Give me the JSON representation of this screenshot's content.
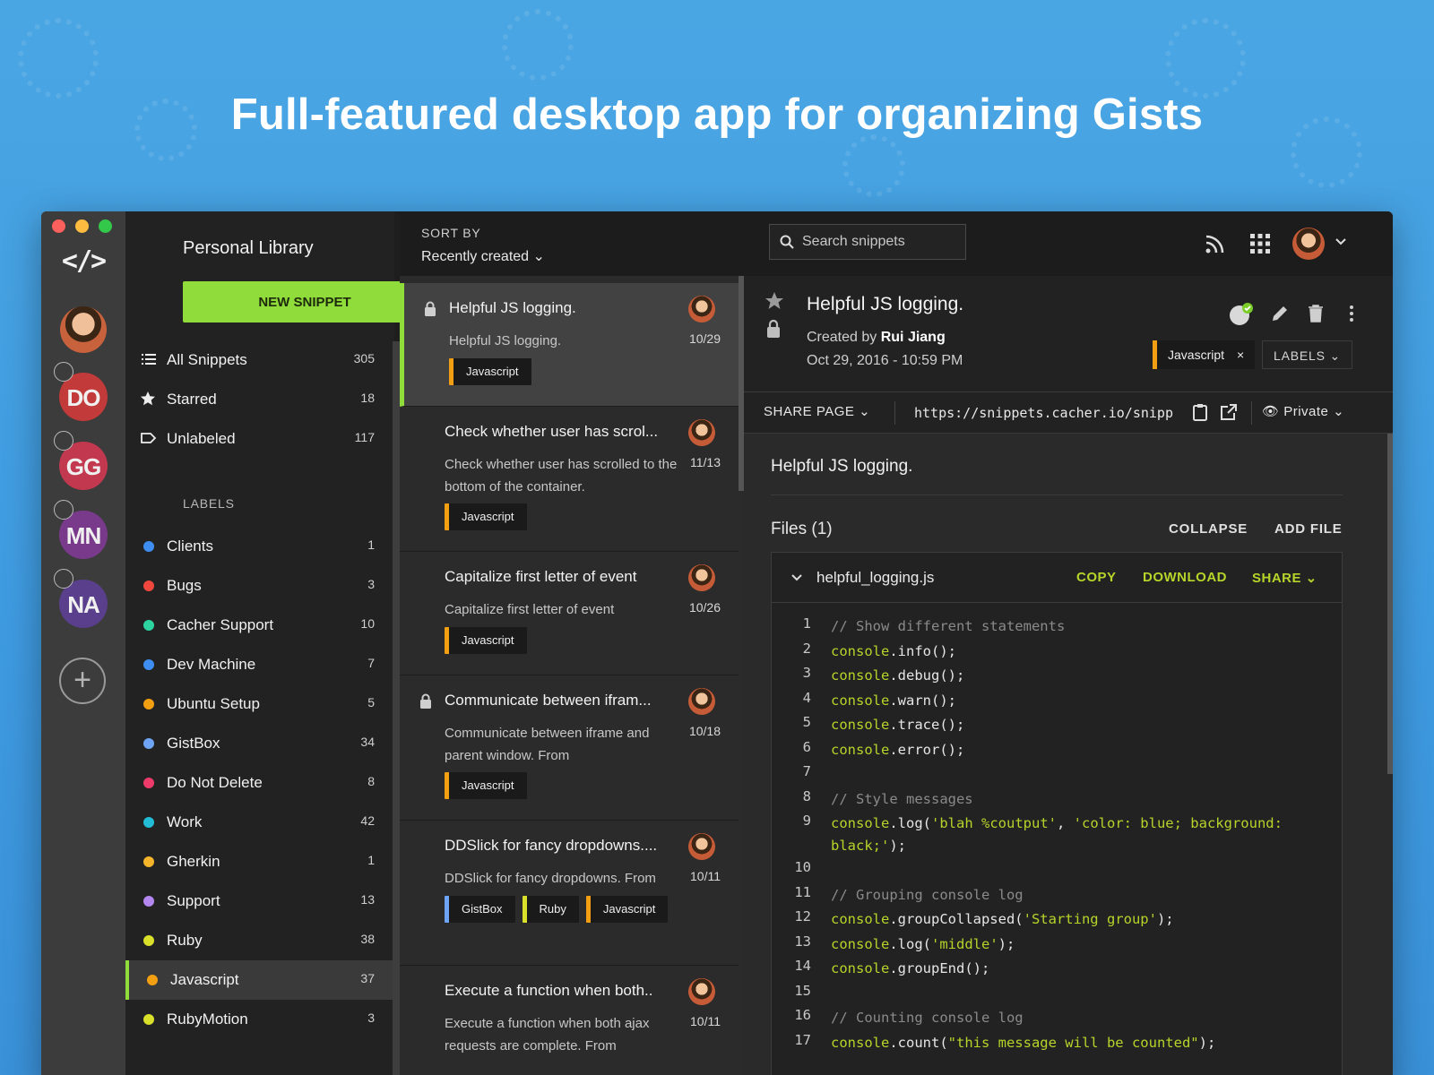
{
  "headline": "Full-featured desktop app for organizing Gists",
  "rail": {
    "logo": "</>",
    "teams": [
      {
        "initials": "DO",
        "color": "#c23a3a"
      },
      {
        "initials": "GG",
        "color": "#c2394f"
      },
      {
        "initials": "MN",
        "color": "#7a3a8c"
      },
      {
        "initials": "NA",
        "color": "#5a3f8c"
      }
    ],
    "add_team": "+"
  },
  "sidebar": {
    "title": "Personal Library",
    "new_snippet": "NEW SNIPPET",
    "nav": [
      {
        "label": "All Snippets",
        "count": "305",
        "icon": "list-icon"
      },
      {
        "label": "Starred",
        "count": "18",
        "icon": "star-icon"
      },
      {
        "label": "Unlabeled",
        "count": "117",
        "icon": "tag-outline-icon"
      }
    ],
    "labels_heading": "LABELS",
    "labels": [
      {
        "label": "Clients",
        "count": "1",
        "color": "#3d8ef0"
      },
      {
        "label": "Bugs",
        "count": "3",
        "color": "#f0483d"
      },
      {
        "label": "Cacher Support",
        "count": "10",
        "color": "#2dd4a0"
      },
      {
        "label": "Dev Machine",
        "count": "7",
        "color": "#3d8ef0"
      },
      {
        "label": "Ubuntu Setup",
        "count": "5",
        "color": "#f29f12"
      },
      {
        "label": "GistBox",
        "count": "34",
        "color": "#6da4f5"
      },
      {
        "label": "Do Not Delete",
        "count": "8",
        "color": "#ee3b6a"
      },
      {
        "label": "Work",
        "count": "42",
        "color": "#22bcd6"
      },
      {
        "label": "Gherkin",
        "count": "1",
        "color": "#f5b52a"
      },
      {
        "label": "Support",
        "count": "13",
        "color": "#b486f0"
      },
      {
        "label": "Ruby",
        "count": "38",
        "color": "#d8e02a"
      },
      {
        "label": "Javascript",
        "count": "37",
        "color": "#f29f12"
      },
      {
        "label": "RubyMotion",
        "count": "3",
        "color": "#d8e02a"
      }
    ]
  },
  "list": {
    "sort_label": "SORT BY",
    "sort_value": "Recently created",
    "items": [
      {
        "title": "Helpful JS logging.",
        "desc": "Helpful JS logging.",
        "date": "10/29",
        "locked": true,
        "tags": [
          {
            "name": "Javascript",
            "color": "#f29f12"
          }
        ]
      },
      {
        "title": "Check whether user has scrol...",
        "desc": "Check whether user has scrolled to the bottom of the container.",
        "date": "11/13",
        "locked": false,
        "tags": [
          {
            "name": "Javascript",
            "color": "#f29f12"
          }
        ]
      },
      {
        "title": "Capitalize first letter of event",
        "desc": "Capitalize first letter of event",
        "date": "10/26",
        "locked": false,
        "tags": [
          {
            "name": "Javascript",
            "color": "#f29f12"
          }
        ]
      },
      {
        "title": "Communicate between ifram...",
        "desc": "Communicate between iframe and parent window. From",
        "date": "10/18",
        "locked": true,
        "tags": [
          {
            "name": "Javascript",
            "color": "#f29f12"
          }
        ]
      },
      {
        "title": "DDSlick for fancy dropdowns....",
        "desc": "DDSlick for fancy dropdowns. From",
        "date": "10/11",
        "locked": false,
        "tags": [
          {
            "name": "GistBox",
            "color": "#6da4f5"
          },
          {
            "name": "Ruby",
            "color": "#d8e02a"
          },
          {
            "name": "Javascript",
            "color": "#f29f12"
          }
        ]
      },
      {
        "title": "Execute a function when both..",
        "desc": "Execute a function when both ajax requests are complete. From",
        "date": "10/11",
        "locked": false,
        "tags": []
      }
    ]
  },
  "topbar": {
    "search_placeholder": "Search snippets"
  },
  "detail": {
    "title": "Helpful JS logging.",
    "created_prefix": "Created by",
    "author": "Rui Jiang",
    "date": "Oct 29, 2016 - 10:59 PM",
    "tag": "Javascript",
    "tag_remove": "×",
    "labels_btn": "LABELS",
    "share_page": "SHARE PAGE",
    "url": "https://snippets.cacher.io/snipp",
    "privacy": "Private",
    "description": "Helpful JS logging.",
    "files_label": "Files (1)",
    "collapse": "COLLAPSE",
    "add_file": "ADD FILE",
    "file": {
      "name": "helpful_logging.js",
      "copy": "COPY",
      "download": "DOWNLOAD",
      "share": "SHARE",
      "lines": [
        {
          "n": "1",
          "parts": [
            [
              "cm",
              "// Show different statements"
            ]
          ]
        },
        {
          "n": "2",
          "parts": [
            [
              "kw",
              "console"
            ],
            [
              "",
              ".info();"
            ]
          ]
        },
        {
          "n": "3",
          "parts": [
            [
              "kw",
              "console"
            ],
            [
              "",
              ".debug();"
            ]
          ]
        },
        {
          "n": "4",
          "parts": [
            [
              "kw",
              "console"
            ],
            [
              "",
              ".warn();"
            ]
          ]
        },
        {
          "n": "5",
          "parts": [
            [
              "kw",
              "console"
            ],
            [
              "",
              ".trace();"
            ]
          ]
        },
        {
          "n": "6",
          "parts": [
            [
              "kw",
              "console"
            ],
            [
              "",
              ".error();"
            ]
          ]
        },
        {
          "n": "7",
          "parts": []
        },
        {
          "n": "8",
          "parts": [
            [
              "cm",
              "// Style messages"
            ]
          ]
        },
        {
          "n": "9",
          "parts": [
            [
              "kw",
              "console"
            ],
            [
              "",
              ".log("
            ],
            [
              "st",
              "'blah %coutput'"
            ],
            [
              "",
              ", "
            ],
            [
              "st",
              "'color: blue; background: black;'"
            ],
            [
              "",
              ");"
            ]
          ],
          "wrap": true
        },
        {
          "n": "10",
          "parts": []
        },
        {
          "n": "11",
          "parts": [
            [
              "cm",
              "// Grouping console log"
            ]
          ]
        },
        {
          "n": "12",
          "parts": [
            [
              "kw",
              "console"
            ],
            [
              "",
              ".groupCollapsed("
            ],
            [
              "st",
              "'Starting group'"
            ],
            [
              "",
              ");"
            ]
          ]
        },
        {
          "n": "13",
          "parts": [
            [
              "kw",
              "console"
            ],
            [
              "",
              ".log("
            ],
            [
              "st",
              "'middle'"
            ],
            [
              "",
              ");"
            ]
          ]
        },
        {
          "n": "14",
          "parts": [
            [
              "kw",
              "console"
            ],
            [
              "",
              ".groupEnd();"
            ]
          ]
        },
        {
          "n": "15",
          "parts": []
        },
        {
          "n": "16",
          "parts": [
            [
              "cm",
              "// Counting console log"
            ]
          ]
        },
        {
          "n": "17",
          "parts": [
            [
              "kw",
              "console"
            ],
            [
              "",
              ".count("
            ],
            [
              "st",
              "\"this message will be counted\""
            ],
            [
              "",
              ");"
            ]
          ]
        }
      ]
    }
  }
}
